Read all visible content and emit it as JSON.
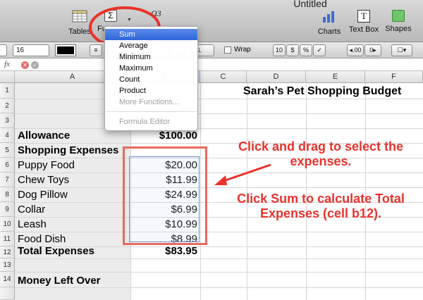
{
  "window": {
    "title": "Untitled"
  },
  "toolbar": {
    "tables_label": "Tables",
    "functions_label": "Fu",
    "charts_label": "Charts",
    "textbox_label": "Text Box",
    "shapes_label": "Shapes",
    "sigma_symbol": "Σ",
    "textbox_symbol": "T",
    "superscript_glyph": "Ω3"
  },
  "formatbar": {
    "font_size": "16",
    "wrap_label": "Wrap",
    "btn_10": "10",
    "btn_dollar": "$",
    "btn_percent": "%",
    "btn_check": "✓",
    "btn_decimals": "◂.00",
    "btn_decimals_right": "0▸"
  },
  "formula": {
    "fx": "fx",
    "cancel": "✕",
    "accept": "✓"
  },
  "columns": [
    "A",
    "B",
    "C",
    "D",
    "E",
    "F"
  ],
  "rows": [
    "1",
    "2",
    "3",
    "4",
    "5",
    "6",
    "7",
    "8",
    "9",
    "10",
    "11",
    "12",
    "13",
    "14"
  ],
  "sheet": {
    "title": "Sarah’s Pet Shopping Budget",
    "allowance_label": "Allowance",
    "allowance_value": "$100.00",
    "shopping_label": "Shopping Expenses",
    "items": [
      {
        "name": "Puppy Food",
        "price": "$20.00"
      },
      {
        "name": "Chew Toys",
        "price": "$11.99"
      },
      {
        "name": "Dog Pillow",
        "price": "$24.99"
      },
      {
        "name": "Collar",
        "price": "$6.99"
      },
      {
        "name": "Leash",
        "price": "$10.99"
      },
      {
        "name": "Food Dish",
        "price": "$8.99"
      }
    ],
    "total_label": "Total Expenses",
    "total_value": "$83.95",
    "money_left_label": "Money Left Over"
  },
  "menu": {
    "items": [
      "Sum",
      "Average",
      "Minimum",
      "Maximum",
      "Count",
      "Product",
      "More Functions..."
    ],
    "formula_editor": "Formula Editor",
    "selected_index": 0
  },
  "annotations": {
    "select_line1": "Click and drag to select the",
    "select_line2": "expenses.",
    "sum_line1": "Click Sum to calculate Total",
    "sum_line2": "Expenses (cell b12)."
  },
  "colors": {
    "annotation_red": "#e8332c",
    "menu_highlight": "#2f64d8",
    "selection_blue": "#6f8fd0"
  }
}
